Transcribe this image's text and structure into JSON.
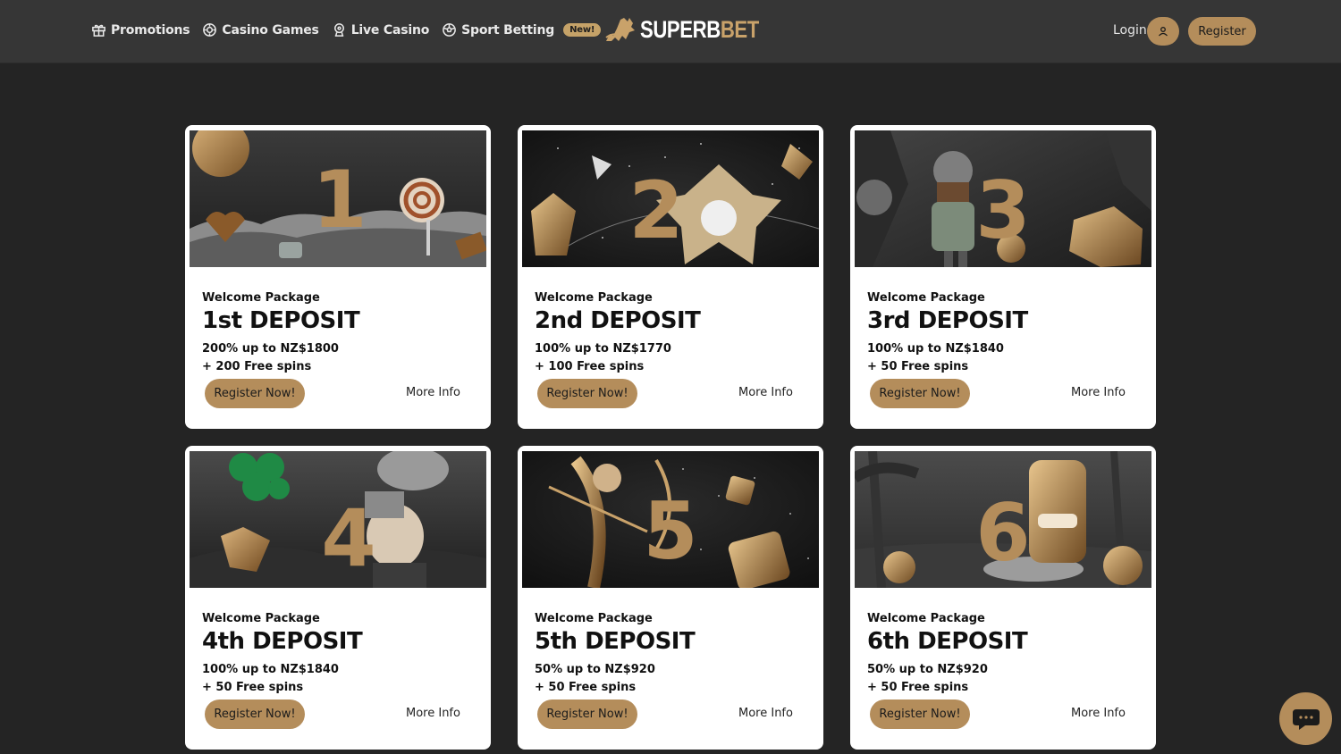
{
  "header": {
    "nav": [
      {
        "label": "Promotions",
        "icon": "gift-icon"
      },
      {
        "label": "Casino Games",
        "icon": "chip-icon"
      },
      {
        "label": "Live Casino",
        "icon": "dealer-icon"
      },
      {
        "label": "Sport Betting",
        "icon": "soccer-ball-icon"
      }
    ],
    "new_badge": "New!",
    "logo": {
      "part1": "SUPERB",
      "part2": "BET"
    },
    "login_label": "Login",
    "register_label": "Register"
  },
  "cards": [
    {
      "eyebrow": "Welcome Package",
      "title": "1st DEPOSIT",
      "line1": "200% up to NZ$1800",
      "line2": "+ 200 Free spins",
      "cta": "Register Now!",
      "more": "More Info",
      "number": "1"
    },
    {
      "eyebrow": "Welcome Package",
      "title": "2nd DEPOSIT",
      "line1": "100% up to NZ$1770",
      "line2": "+ 100 Free spins",
      "cta": "Register Now!",
      "more": "More Info",
      "number": "2"
    },
    {
      "eyebrow": "Welcome Package",
      "title": "3rd DEPOSIT",
      "line1": "100% up to NZ$1840",
      "line2": "+ 50 Free spins",
      "cta": "Register Now!",
      "more": "More Info",
      "number": "3"
    },
    {
      "eyebrow": "Welcome Package",
      "title": "4th DEPOSIT",
      "line1": "100% up to NZ$1840",
      "line2": "+ 50 Free spins",
      "cta": "Register Now!",
      "more": "More Info",
      "number": "4"
    },
    {
      "eyebrow": "Welcome Package",
      "title": "5th DEPOSIT",
      "line1": "50% up to NZ$920",
      "line2": "+ 50 Free spins",
      "cta": "Register Now!",
      "more": "More Info",
      "number": "5"
    },
    {
      "eyebrow": "Welcome Package",
      "title": "6th DEPOSIT",
      "line1": "50% up to NZ$920",
      "line2": "+ 50 Free spins",
      "cta": "Register Now!",
      "more": "More Info",
      "number": "6"
    }
  ],
  "colors": {
    "accent": "#b48d5b",
    "header_bg": "#363636",
    "page_bg": "#242424",
    "card_bg": "#ffffff"
  },
  "chat": {
    "icon": "chat-bubble-icon"
  }
}
